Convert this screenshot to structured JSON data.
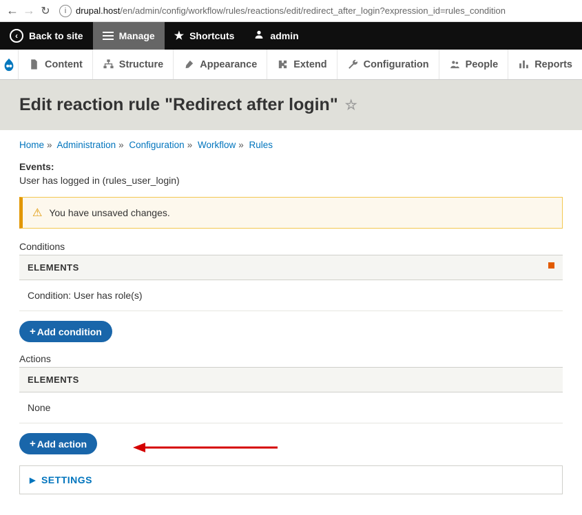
{
  "browser": {
    "url_host": "drupal.host",
    "url_path": "/en/admin/config/workflow/rules/reactions/edit/redirect_after_login?expression_id=rules_condition"
  },
  "toolbar": {
    "back_to_site": "Back to site",
    "manage": "Manage",
    "shortcuts": "Shortcuts",
    "admin": "admin"
  },
  "admin_menu": {
    "items": [
      "Content",
      "Structure",
      "Appearance",
      "Extend",
      "Configuration",
      "People",
      "Reports"
    ]
  },
  "page": {
    "title": "Edit reaction rule \"Redirect after login\""
  },
  "breadcrumb": [
    "Home",
    "Administration",
    "Configuration",
    "Workflow",
    "Rules"
  ],
  "events": {
    "label": "Events:",
    "text": "User has logged in (rules_user_login)"
  },
  "message": "You have unsaved changes.",
  "conditions": {
    "label": "Conditions",
    "header": "ELEMENTS",
    "row": "Condition: User has role(s)",
    "add_button": "Add condition"
  },
  "actions": {
    "label": "Actions",
    "header": "ELEMENTS",
    "row": "None",
    "add_button": "Add action"
  },
  "settings": {
    "label": "SETTINGS"
  }
}
